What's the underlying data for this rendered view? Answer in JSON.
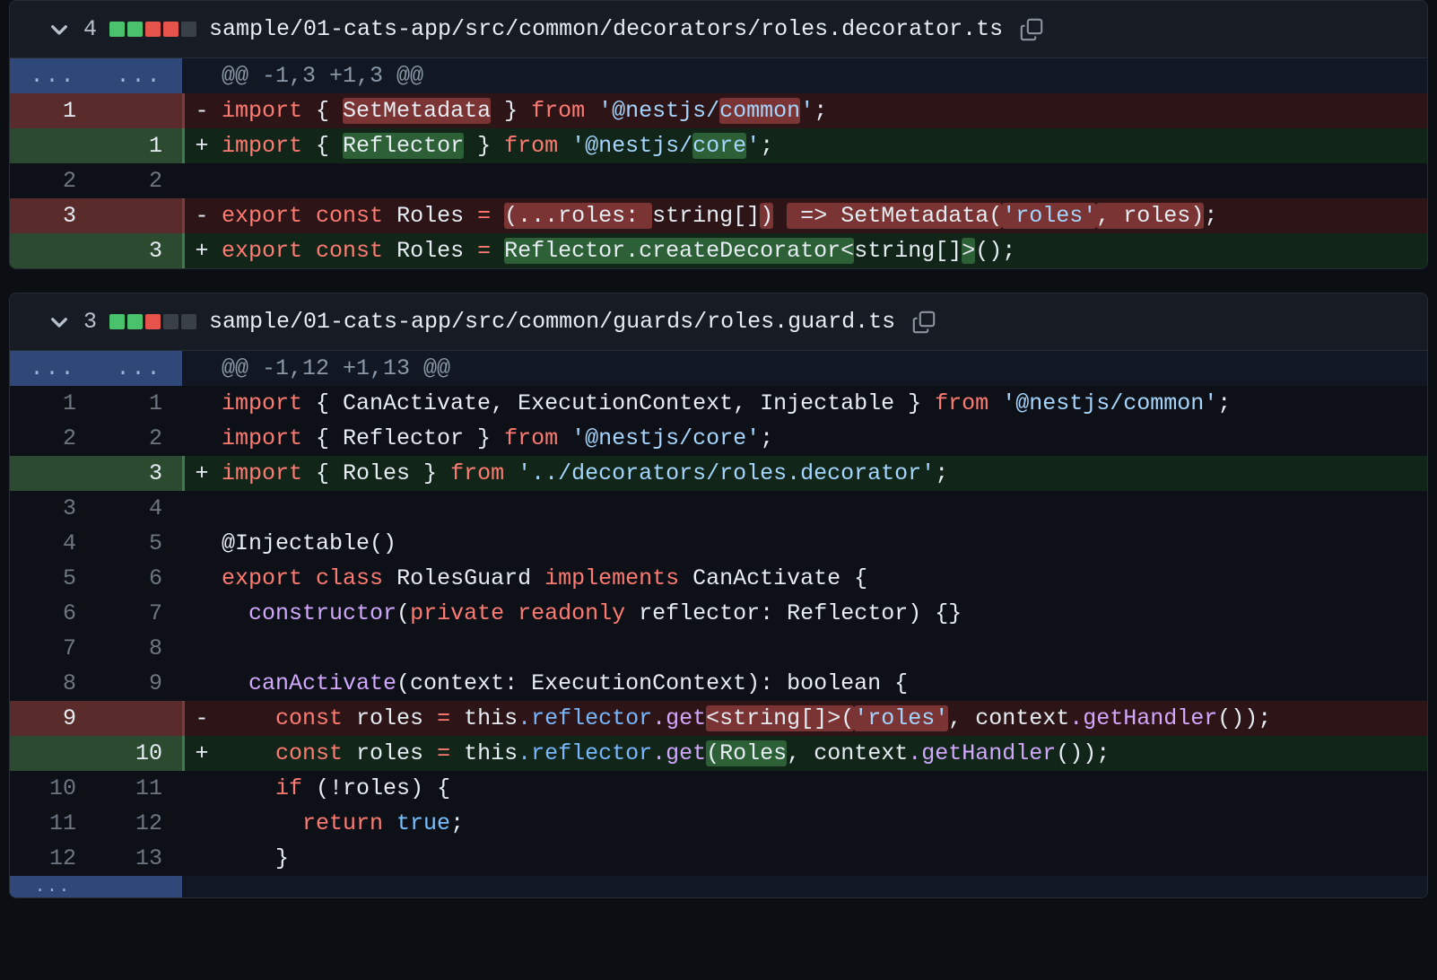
{
  "files": [
    {
      "change_count": "4",
      "path": "sample/01-cats-app/src/common/decorators/roles.decorator.ts",
      "diffstat": [
        "add",
        "add",
        "del",
        "del",
        "non"
      ],
      "collapse_icon": "chevron-down-icon",
      "copy_icon": "copy-icon",
      "hunk_header": "@@ -1,3 +1,3 @@",
      "rows": [
        {
          "type": "hunk",
          "old": "...",
          "new": "...",
          "sign": "",
          "text": "@@ -1,3 +1,3 @@"
        },
        {
          "type": "del",
          "old": "1",
          "new": "",
          "sign": "-",
          "text": "import { SetMetadata } from '@nestjs/common';"
        },
        {
          "type": "add",
          "old": "",
          "new": "1",
          "sign": "+",
          "text": "import { Reflector } from '@nestjs/core';"
        },
        {
          "type": "ctx",
          "old": "2",
          "new": "2",
          "sign": "",
          "text": ""
        },
        {
          "type": "del",
          "old": "3",
          "new": "",
          "sign": "-",
          "text": "export const Roles = (...roles: string[]) => SetMetadata('roles', roles);"
        },
        {
          "type": "add",
          "old": "",
          "new": "3",
          "sign": "+",
          "text": "export const Roles = Reflector.createDecorator<string[]>();"
        }
      ]
    },
    {
      "change_count": "3",
      "path": "sample/01-cats-app/src/common/guards/roles.guard.ts",
      "diffstat": [
        "add",
        "add",
        "del",
        "non",
        "non"
      ],
      "collapse_icon": "chevron-down-icon",
      "copy_icon": "copy-icon",
      "hunk_header": "@@ -1,12 +1,13 @@",
      "rows": [
        {
          "type": "hunk",
          "old": "...",
          "new": "...",
          "sign": "",
          "text": "@@ -1,12 +1,13 @@"
        },
        {
          "type": "ctx",
          "old": "1",
          "new": "1",
          "sign": "",
          "text": "import { CanActivate, ExecutionContext, Injectable } from '@nestjs/common';"
        },
        {
          "type": "ctx",
          "old": "2",
          "new": "2",
          "sign": "",
          "text": "import { Reflector } from '@nestjs/core';"
        },
        {
          "type": "add",
          "old": "",
          "new": "3",
          "sign": "+",
          "text": "import { Roles } from '../decorators/roles.decorator';"
        },
        {
          "type": "ctx",
          "old": "3",
          "new": "4",
          "sign": "",
          "text": ""
        },
        {
          "type": "ctx",
          "old": "4",
          "new": "5",
          "sign": "",
          "text": "@Injectable()"
        },
        {
          "type": "ctx",
          "old": "5",
          "new": "6",
          "sign": "",
          "text": "export class RolesGuard implements CanActivate {"
        },
        {
          "type": "ctx",
          "old": "6",
          "new": "7",
          "sign": "",
          "text": "  constructor(private readonly reflector: Reflector) {}"
        },
        {
          "type": "ctx",
          "old": "7",
          "new": "8",
          "sign": "",
          "text": ""
        },
        {
          "type": "ctx",
          "old": "8",
          "new": "9",
          "sign": "",
          "text": "  canActivate(context: ExecutionContext): boolean {"
        },
        {
          "type": "del",
          "old": "9",
          "new": "",
          "sign": "-",
          "text": "    const roles = this.reflector.get<string[]>('roles', context.getHandler());"
        },
        {
          "type": "add",
          "old": "",
          "new": "10",
          "sign": "+",
          "text": "    const roles = this.reflector.get(Roles, context.getHandler());"
        },
        {
          "type": "ctx",
          "old": "10",
          "new": "11",
          "sign": "",
          "text": "    if (!roles) {"
        },
        {
          "type": "ctx",
          "old": "11",
          "new": "12",
          "sign": "",
          "text": "      return true;"
        },
        {
          "type": "ctx",
          "old": "12",
          "new": "13",
          "sign": "",
          "text": "    }"
        },
        {
          "type": "partial",
          "old": "...",
          "new": "",
          "sign": "",
          "text": ""
        }
      ]
    }
  ],
  "colors": {
    "page_bg": "#0b0e13",
    "block_bg": "#0d1117",
    "header_bg": "#171c24",
    "addition_bg": "#112619",
    "deletion_bg": "#2d1517",
    "hunk_gutter_bg": "#2f4878",
    "diffstat_add": "#4ac26b",
    "diffstat_del": "#e5534b",
    "diffstat_neutral": "#3a4048",
    "keyword": "#ff7b72",
    "string": "#a5d6ff",
    "function": "#d2a8ff",
    "property": "#79b8ff",
    "constant": "#79c0ff",
    "text": "#e6edf3"
  }
}
